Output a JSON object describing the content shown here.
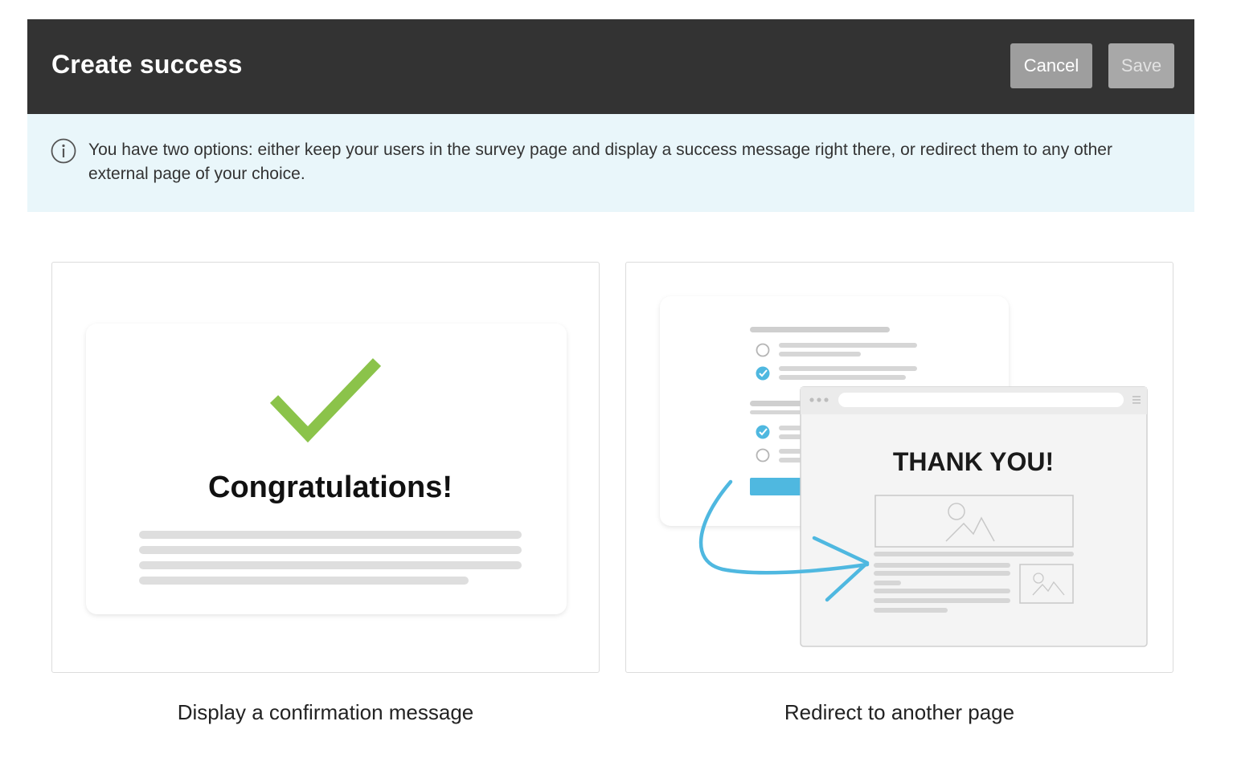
{
  "header": {
    "title": "Create success",
    "cancel_label": "Cancel",
    "save_label": "Save"
  },
  "info": {
    "icon": "info-circle-icon",
    "text": "You have two options: either keep your users in the survey page and display a success message right there, or redirect them to any other external page of your choice."
  },
  "options": [
    {
      "illustration_heading": "Congratulations!",
      "label": "Display a confirmation message"
    },
    {
      "illustration_heading": "THANK YOU!",
      "label": "Redirect to another page"
    }
  ],
  "colors": {
    "header_bg": "#333333",
    "info_bg": "#e9f6fa",
    "check_green": "#8bc34a",
    "accent_blue": "#4fb8e0"
  }
}
